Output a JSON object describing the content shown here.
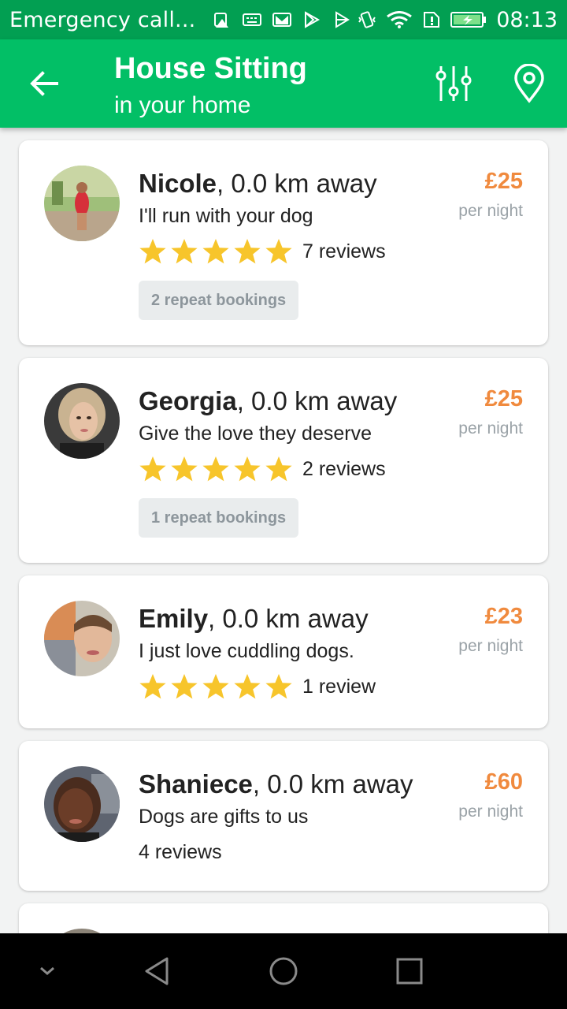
{
  "statusbar": {
    "notification_text": "Emergency call...",
    "time": "08:13",
    "left_icons": [
      "alert-icon",
      "keyboard-icon",
      "gmail-icon",
      "play-store-icon",
      "play-icon"
    ],
    "right_icons": [
      "vibrate-icon",
      "wifi-icon",
      "sim-alert-icon",
      "battery-charging-icon"
    ]
  },
  "toolbar": {
    "title": "House Sitting",
    "subtitle": "in your home",
    "back_icon": "arrow-back-icon",
    "filter_icon": "sliders-icon",
    "location_icon": "location-pin-icon"
  },
  "colors": {
    "status_bar": "#029f52",
    "toolbar": "#02bf66",
    "price": "#f08a3e",
    "star": "#f7c52b"
  },
  "sitters": [
    {
      "name": "Nicole",
      "distance": ", 0.0 km away",
      "tagline": "I'll run with your dog",
      "stars": 5,
      "reviews": "7 reviews",
      "repeat_bookings": "2 repeat bookings",
      "price": "£25",
      "per": "per night"
    },
    {
      "name": "Georgia",
      "distance": ", 0.0 km away",
      "tagline": "Give the love they deserve",
      "stars": 5,
      "reviews": "2 reviews",
      "repeat_bookings": "1 repeat bookings",
      "price": "£25",
      "per": "per night"
    },
    {
      "name": "Emily",
      "distance": ", 0.0 km away",
      "tagline": "I just love cuddling dogs.",
      "stars": 5,
      "reviews": "1 review",
      "price": "£23",
      "per": "per night"
    },
    {
      "name": "Shaniece",
      "distance": ", 0.0 km away",
      "tagline": "Dogs are gifts to us",
      "stars": 0,
      "reviews": "4 reviews",
      "price": "£60",
      "per": "per night"
    }
  ],
  "navbar": {
    "icons": [
      "chevron-down-icon",
      "back-triangle-icon",
      "home-circle-icon",
      "recents-square-icon"
    ]
  }
}
